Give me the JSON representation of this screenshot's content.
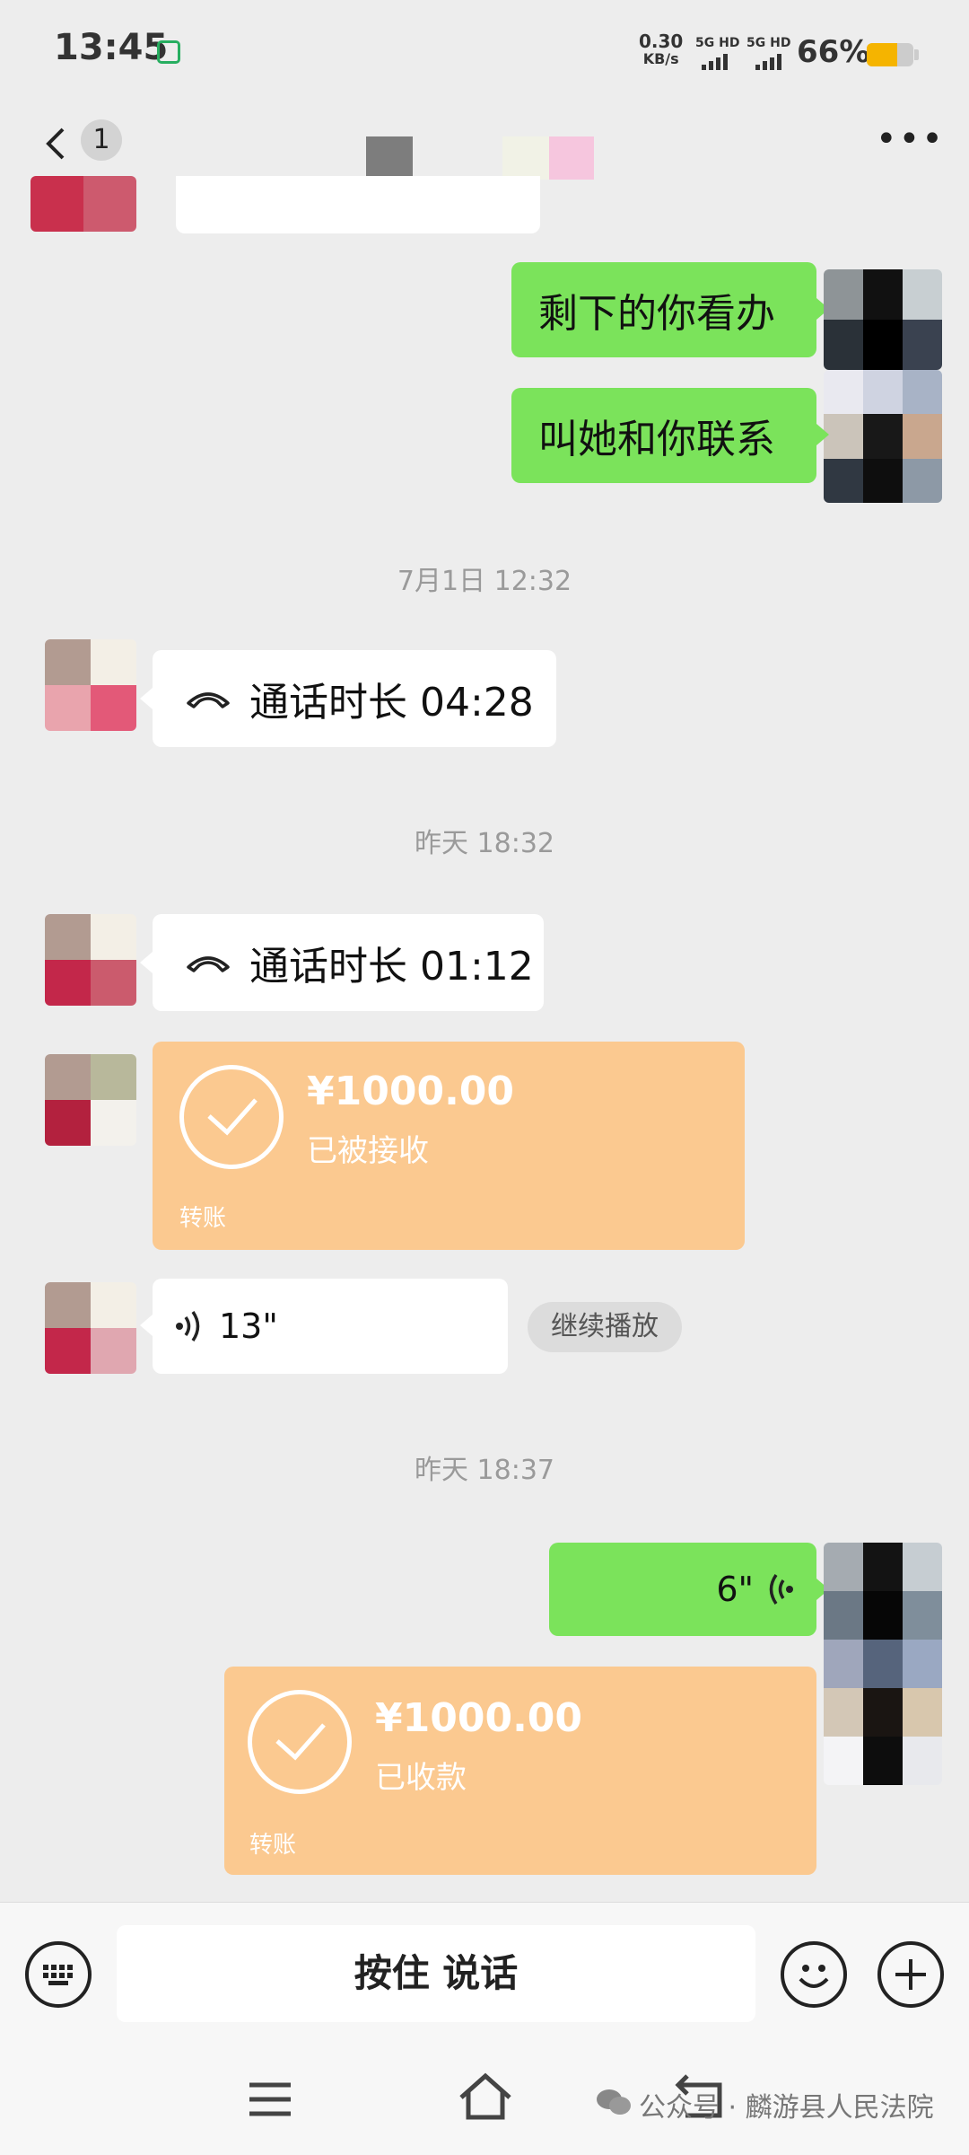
{
  "status_bar": {
    "time": "13:45",
    "net_speed_value": "0.30",
    "net_speed_unit": "KB/s",
    "signal1": "5G HD",
    "signal2": "5G HD",
    "battery": "66%",
    "battery_level": 0.66,
    "battery_color": "#f5b400"
  },
  "header": {
    "unread_count": "1",
    "back_icon": "chevron-left-icon",
    "more_icon": "more-dots-icon"
  },
  "messages": {
    "sent_text_1": "剩下的你看办",
    "sent_text_2": "叫她和你联系",
    "time_1": "7月1日 12:32",
    "call_1": "通话时长 04:28",
    "time_2": "昨天 18:32",
    "call_2": "通话时长 01:12",
    "transfer_1": {
      "amount": "¥1000.00",
      "status": "已被接收",
      "kind": "转账"
    },
    "voice_in": "13\"",
    "continue_play": "继续播放",
    "time_3": "昨天 18:37",
    "voice_out": "6\"",
    "transfer_2": {
      "amount": "¥1000.00",
      "status": "已收款",
      "kind": "转账"
    }
  },
  "input_bar": {
    "hold_to_talk": "按住 说话",
    "keyboard_icon": "keyboard-icon",
    "emoji_icon": "smile-icon",
    "plus_icon": "plus-icon"
  },
  "watermark": "公众号 · 麟游县人民法院",
  "colors": {
    "sent_bubble": "#7be35b",
    "transfer_card": "#fbc990",
    "background": "#ededed"
  }
}
